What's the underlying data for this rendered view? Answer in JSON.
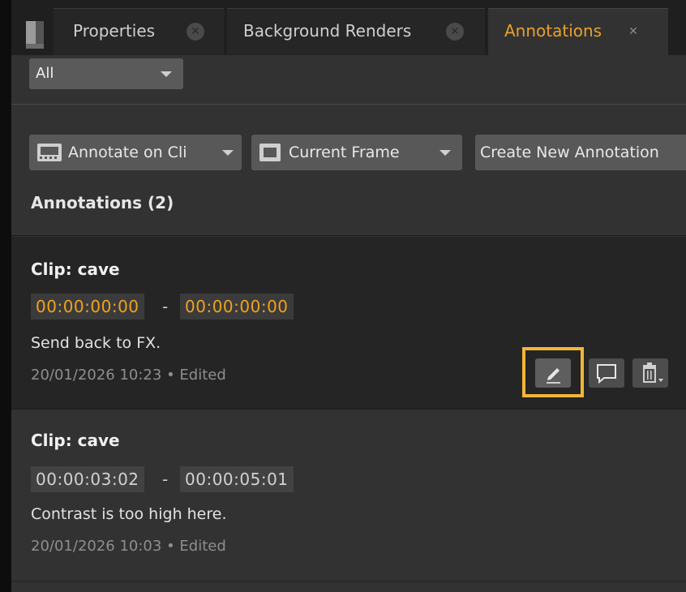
{
  "tabs": [
    {
      "label": "Properties",
      "active": false
    },
    {
      "label": "Background Renders",
      "active": false
    },
    {
      "label": "Annotations",
      "active": true
    }
  ],
  "filter": {
    "selected": "All"
  },
  "toolbar": {
    "annotate_on": "Annotate on Cli",
    "frame_mode": "Current Frame",
    "create_new": "Create New Annotation"
  },
  "section_title": "Annotations (2)",
  "annotations": [
    {
      "clip": "Clip: cave",
      "tc_in": "00:00:00:00",
      "tc_out": "00:00:00:00",
      "separator": "-",
      "note": "Send back to FX.",
      "meta": "20/01/2026 10:23 • Edited",
      "highlighted_action": "edit"
    },
    {
      "clip": "Clip: cave",
      "tc_in": "00:00:03:02",
      "tc_out": "00:00:05:01",
      "separator": "-",
      "note": "Contrast is too high here.",
      "meta": "20/01/2026 10:03 • Edited"
    }
  ],
  "colors": {
    "accent_orange": "#f2a21c",
    "highlight_box": "#f2b53a",
    "panel_bg": "#323232",
    "card_bg": "#252525"
  },
  "icons": {
    "tab_close": "close-icon",
    "annotate": "film-icon",
    "frame": "frame-icon",
    "edit": "pencil-icon",
    "comment": "comment-icon",
    "delete": "trash-icon"
  }
}
